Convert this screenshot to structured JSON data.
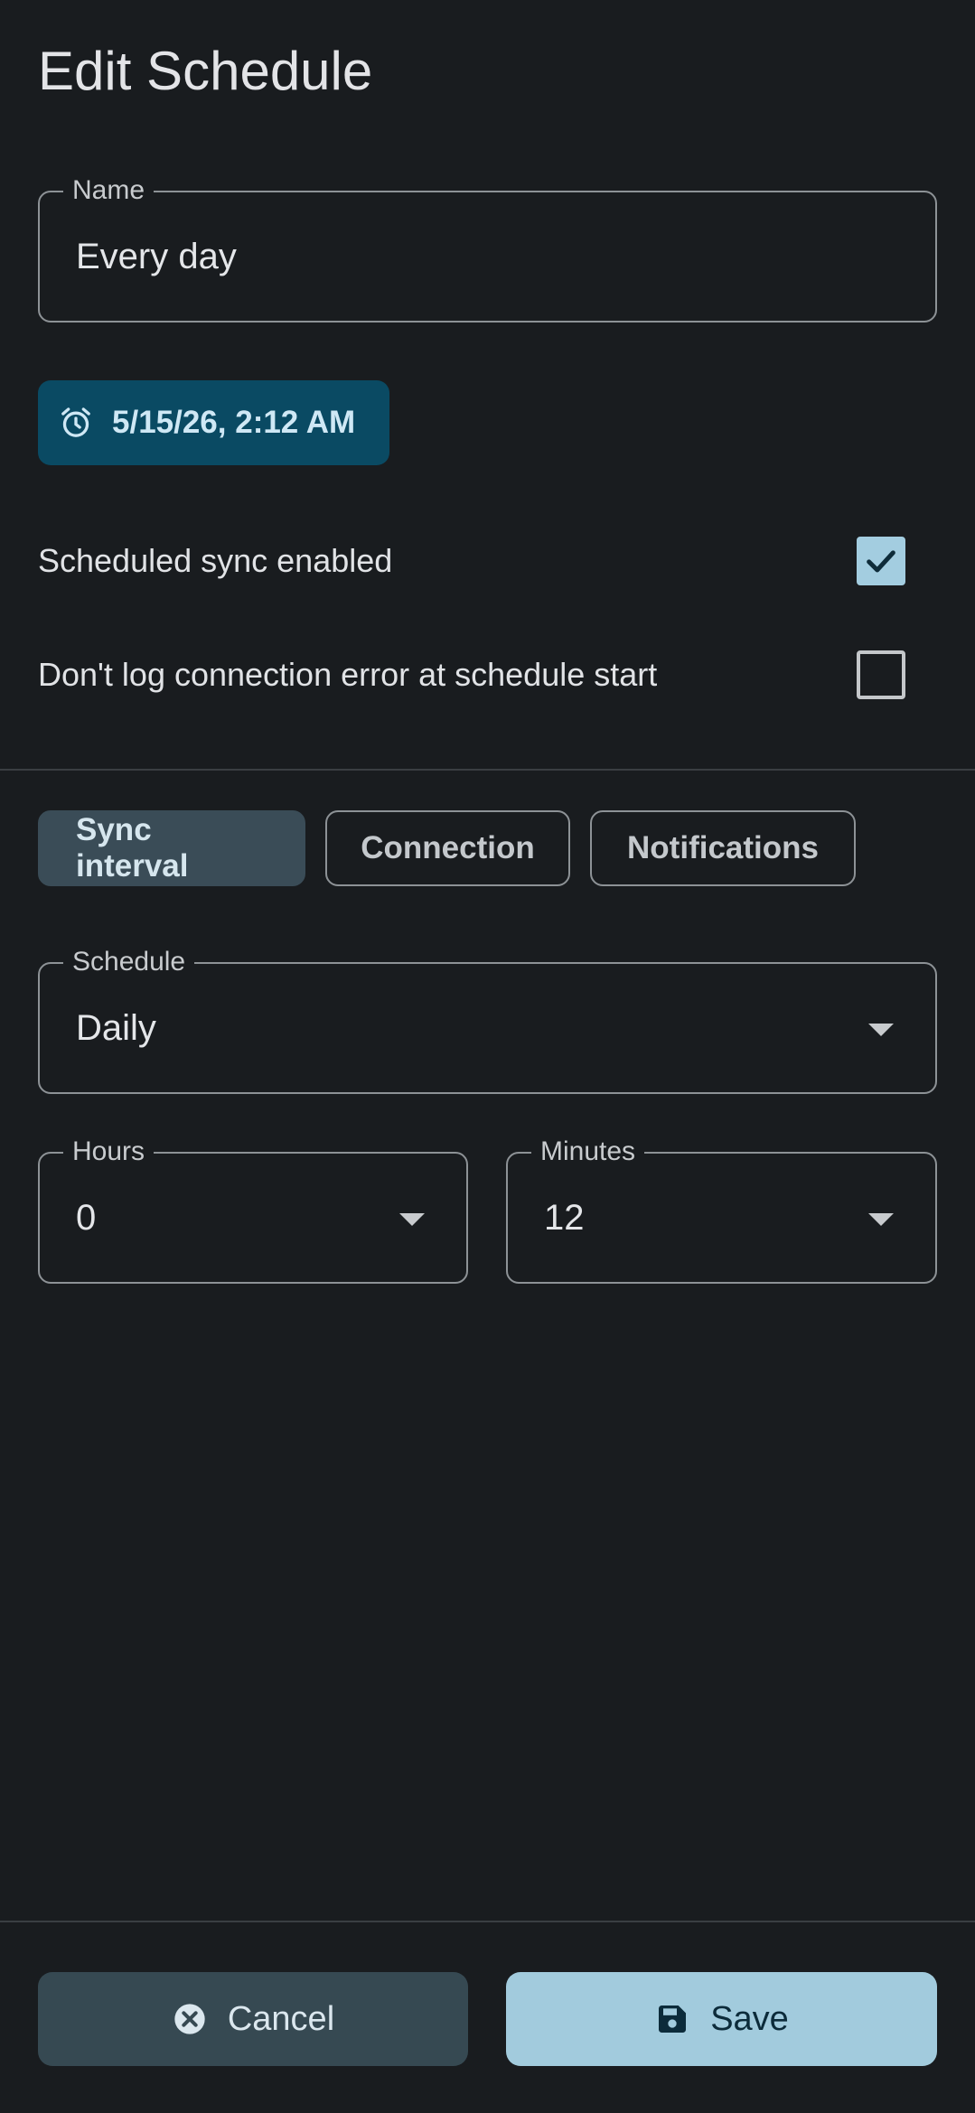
{
  "title": "Edit Schedule",
  "name_field": {
    "label": "Name",
    "value": "Every day"
  },
  "date_chip": {
    "icon": "alarm-clock-icon",
    "text": "5/15/26, 2:12 AM"
  },
  "toggles": [
    {
      "label": "Scheduled sync enabled",
      "checked": true
    },
    {
      "label": "Don't log connection error at schedule start",
      "checked": false
    }
  ],
  "tabs": [
    {
      "label": "Sync interval",
      "active": true
    },
    {
      "label": "Connection",
      "active": false
    },
    {
      "label": "Notifications",
      "active": false
    }
  ],
  "schedule_field": {
    "label": "Schedule",
    "value": "Daily"
  },
  "hours_field": {
    "label": "Hours",
    "value": "0"
  },
  "minutes_field": {
    "label": "Minutes",
    "value": "12"
  },
  "buttons": {
    "cancel_label": "Cancel",
    "cancel_icon": "cancel-circle-icon",
    "save_label": "Save",
    "save_icon": "floppy-disk-icon"
  },
  "colors": {
    "background": "#191c1f",
    "accent": "#a2cbdd",
    "chip": "#0a4a63"
  }
}
